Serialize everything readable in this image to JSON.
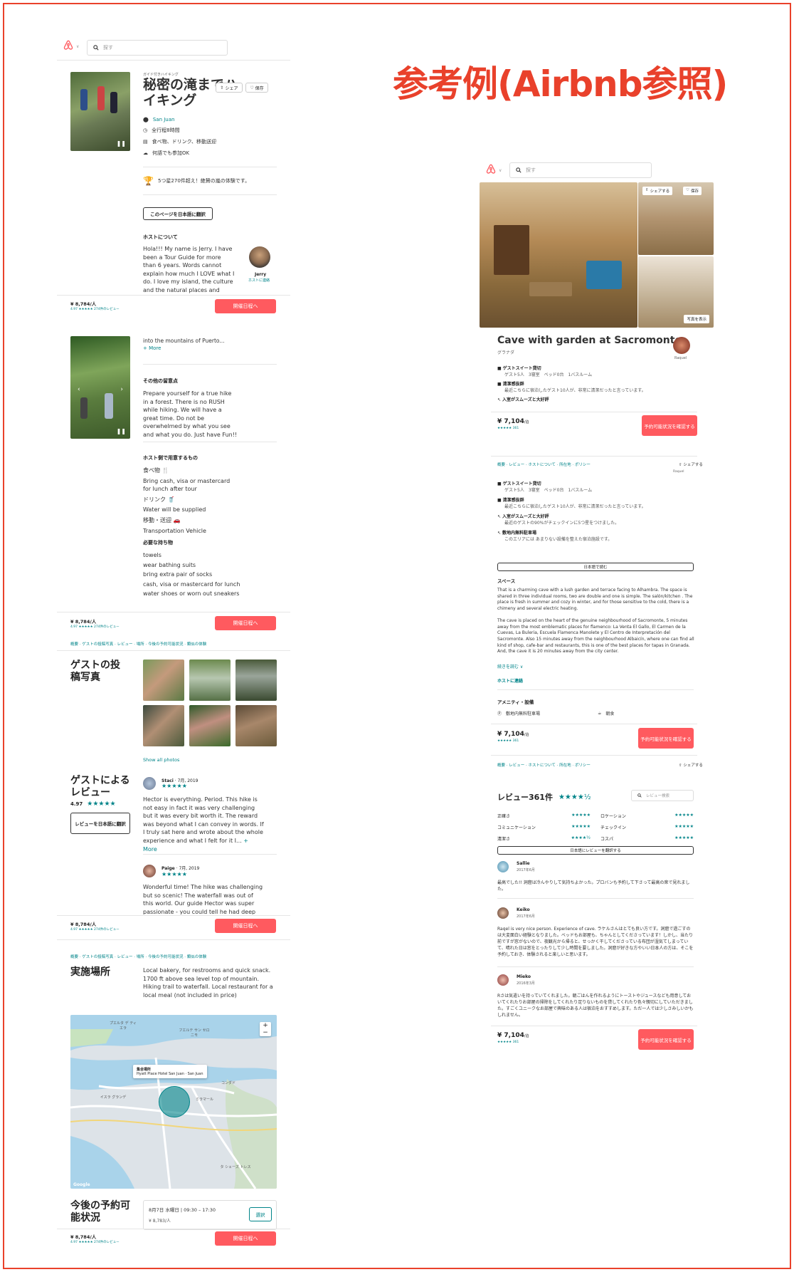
{
  "headline": "参考例(Airbnb参照)",
  "left": {
    "search_placeholder": "探す",
    "category": "ガイド付きハイキング",
    "title": "秘密の滝までハイキング",
    "share": "シェア",
    "save": "保存",
    "facts": [
      {
        "icon": "pin-icon",
        "text": "San Juan"
      },
      {
        "icon": "clock-icon",
        "text": "全行程8時間"
      },
      {
        "icon": "receipt-icon",
        "text": "食べ物、ドリンク、移動送迎"
      },
      {
        "icon": "chat-icon",
        "text": "何語でも参加OK"
      }
    ],
    "trophy_text": "5つ星270件超え！絶賛の嵐の体験です。",
    "translate_btn": "このページを日本語に翻訳",
    "host_heading": "ホストについて",
    "host_text": "Hola!!! My name is Jerry. I have been a Tour Guide for more than 6 years. Words cannot explain how much I LOVE what I do. I love my island, the culture and the natural places and people. Being a guide helps me",
    "host_name": "Jerry",
    "host_contact": "ホストに連絡",
    "price": "¥ 8,784/人",
    "rating_line": "4.97 ★★★★★ 274件のレビュー",
    "book_btn": "開催日程へ",
    "more_text": "into the mountains of Puerto...",
    "more_link": "+ More",
    "notes_heading": "その他の留意点",
    "notes_text": "Prepare yourself for a true hike in a forest. There is no RUSH while hiking. We will have a great time. Do not be overwhelmed by what you see and what you do. Just have Fun!!",
    "provide_heading": "ホスト側で用意するもの",
    "provide_items": [
      "食べ物 🍴",
      "Bring cash, visa or mastercard for lunch after tour",
      "ドリンク 🥤",
      "Water will be supplied",
      "移動・送迎 🚗",
      "Transportation Vehicle"
    ],
    "bring_heading": "必要な持ち物",
    "bring_items": [
      "towels",
      "wear bathing suits",
      "bring extra pair of socks",
      "cash, visa or mastercard for lunch",
      "water shoes or worn out sneakers"
    ],
    "nav1": "概要 · ゲストの投稿写真 · レビュー · 場所 · 今後の予約可能状況 · 類似の体験",
    "photos_heading": "ゲストの投稿写真",
    "show_all_photos": "Show all photos",
    "reviews_heading": "ゲストによるレビュー",
    "reviews_score": "4.97",
    "reviews_translate": "レビューを日本語に翻訳",
    "reviews": [
      {
        "name": "Staci",
        "date": "7月, 2019",
        "text": "Hector is everything. Period. This hike is not easy in fact it was very challenging but it was every bit worth it. The reward was beyond what I can convey in words. If I truly sat here and wrote about the whole experience and what I felt for it I...",
        "more": "+ More"
      },
      {
        "name": "Paige",
        "date": "7月, 2019",
        "text": "Wonderful time! The hike was challenging but so scenic! The waterfall was out of this world. Our guide Hector was super passionate - you could tell he had deep personal connection to",
        "more": ""
      }
    ],
    "nav2": "概要 · ゲストの投稿写真 · レビュー · 場所 · 今後の予約可能状況 · 類似の体験",
    "location_heading": "実施場所",
    "location_text": "Local bakery, for restrooms and quick snack. 1700 ft above sea level top of mountain. Hiking trail to waterfall. Local restaurant for a local meal (not included in price)",
    "map_popup_title": "集合場所",
    "map_popup_sub": "Hyatt Place Hotel San Juan · San Juan",
    "map_labels": [
      "プエルタ デ ティエラ",
      "フエルテ サン セロニモ",
      "イスラ グランデ",
      "ミラマール",
      "コンダド",
      "タ シェーズ トレス"
    ],
    "map_zoom_in": "+",
    "map_zoom_out": "−",
    "map_attr": "Google",
    "availability_heading": "今後の予約可能状況",
    "availability_date": "8月7日 水曜日",
    "availability_time": "09:30 – 17:30",
    "availability_price": "¥ 8,783/人",
    "availability_select": "選択"
  },
  "right": {
    "search_placeholder": "探す",
    "share": "シェアする",
    "save": "保存",
    "show_photos": "写真を表示",
    "title": "Cave with garden at Sacromonte",
    "location": "グラナダ",
    "host_name": "Raquel",
    "features": [
      {
        "title": "ゲストスイート貸切",
        "sub": "ゲスト5人　3寝室　ベッド0台　1バスルーム"
      },
      {
        "title": "清潔感抜群",
        "sub": "最近こちらに宿泊したゲスト10人が、非常に清潔だったと言っています。"
      },
      {
        "title": "入室がスムーズと大好評",
        "sub": ""
      }
    ],
    "price": "¥ 7,104",
    "price_unit": "/泊",
    "rating_line": "★★★★★ 361",
    "reserve_btn": "予約可能状況を確認する",
    "nav": "概要 · レビュー · ホストについて · 所在地 · ポリシー",
    "nav_share": "シェアする",
    "features2": [
      {
        "title": "ゲストスイート貸切",
        "sub": "ゲスト5人　3寝室　ベッド0台　1バスルーム"
      },
      {
        "title": "清潔感抜群",
        "sub": "最近こちらに宿泊したゲスト10人が、非常に清潔だったと言っています。"
      },
      {
        "title": "入室がスムーズと大好評",
        "sub": "最近のゲストの90%がチェックインに5つ星をつけました。"
      },
      {
        "title": "敷地内無料駐車場",
        "sub": "このエリアには あまりない設備を整えた宿泊施設です。"
      }
    ],
    "read_jp_btn": "日本語で読む",
    "space_heading": "スペース",
    "space_p1": "That is a charming cave with a lush garden and terrace facing to Alhambra. The space is shared in three individual rooms, two are double and one is simple. The salón/kitchen . The place is fresh in summer and cozy in winter, and for those sensitive to the cold, there is a chimeny and several electric heating.",
    "space_p2": "The cave is placed on the heart of the genuine neighbourhood of Sacromonte, 5 minutes away from the most emblematic places for flamenco: La Venta El Gallo, El Carmen de la Cuevas, La Buleria, Escuela Flamenca Manolete y El Centro de Interpretación del Sacromonte. Also 15 minutes away from the neighbourhood Albaicín, where one can find all kind of shop, cafe-bar and restaurants, this is one of the best places for tapas in Granada. And, the cave it is 20 minutes away from the city center.",
    "read_more": "続きを読む ∨",
    "contact_host": "ホストに連絡",
    "amenities_heading": "アメニティ・設備",
    "amenities": [
      "敷地内無料駐車場",
      "朝食"
    ],
    "reviews_heading": "レビュー361件",
    "review_search": "レビュー検索",
    "categories": [
      {
        "name": "正確さ",
        "stars": "★★★★★"
      },
      {
        "name": "ロケーション",
        "stars": "★★★★★"
      },
      {
        "name": "コミュニケーション",
        "stars": "★★★★★"
      },
      {
        "name": "チェックイン",
        "stars": "★★★★★"
      },
      {
        "name": "清潔さ",
        "stars": "★★★★½"
      },
      {
        "name": "コスパ",
        "stars": "★★★★★"
      }
    ],
    "translate_reviews_btn": "日本語にレビューを翻訳する",
    "reviews": [
      {
        "name": "Sallie",
        "date": "2017年6月",
        "text": "最高でした!! 洞窟は冷んやりして気持ちよかった。プロバンも予約して下さって最高の席で見れました。"
      },
      {
        "name": "Keiko",
        "date": "2017年6月",
        "text": "Raqel is very nice person. Experience of cave. ラケルさんはとても良い方です。洞窟で過ごすのは大変面白い経験となりました。ベッドもお部屋も、ちゃんとしてくださっています！しかし、当たり前ですが窓がないので、夜観光から帰ると、せっかく干してくださっている布団が湿気てしまっていて、晴れた日は窓をとったりして少し時間を要しました。洞窟が好きな方やいい日本人の方は、そこを予約しておき、体験されると楽しいと思います。"
      },
      {
        "name": "Mieko",
        "date": "2016年3月",
        "text": "Rさは気遣いを持っていてくれました。朝ごはんを作れるようにトーストやジュースなども用意しておいてくれたりお部屋の掃除をしてくれたり足りないものを貸してくれたり色々親切にしていただきました。すごくユニークなお部屋で興味のある人は宿泊をおすすめします。ただ一人では少しさみしいかもしれません。"
      }
    ]
  }
}
